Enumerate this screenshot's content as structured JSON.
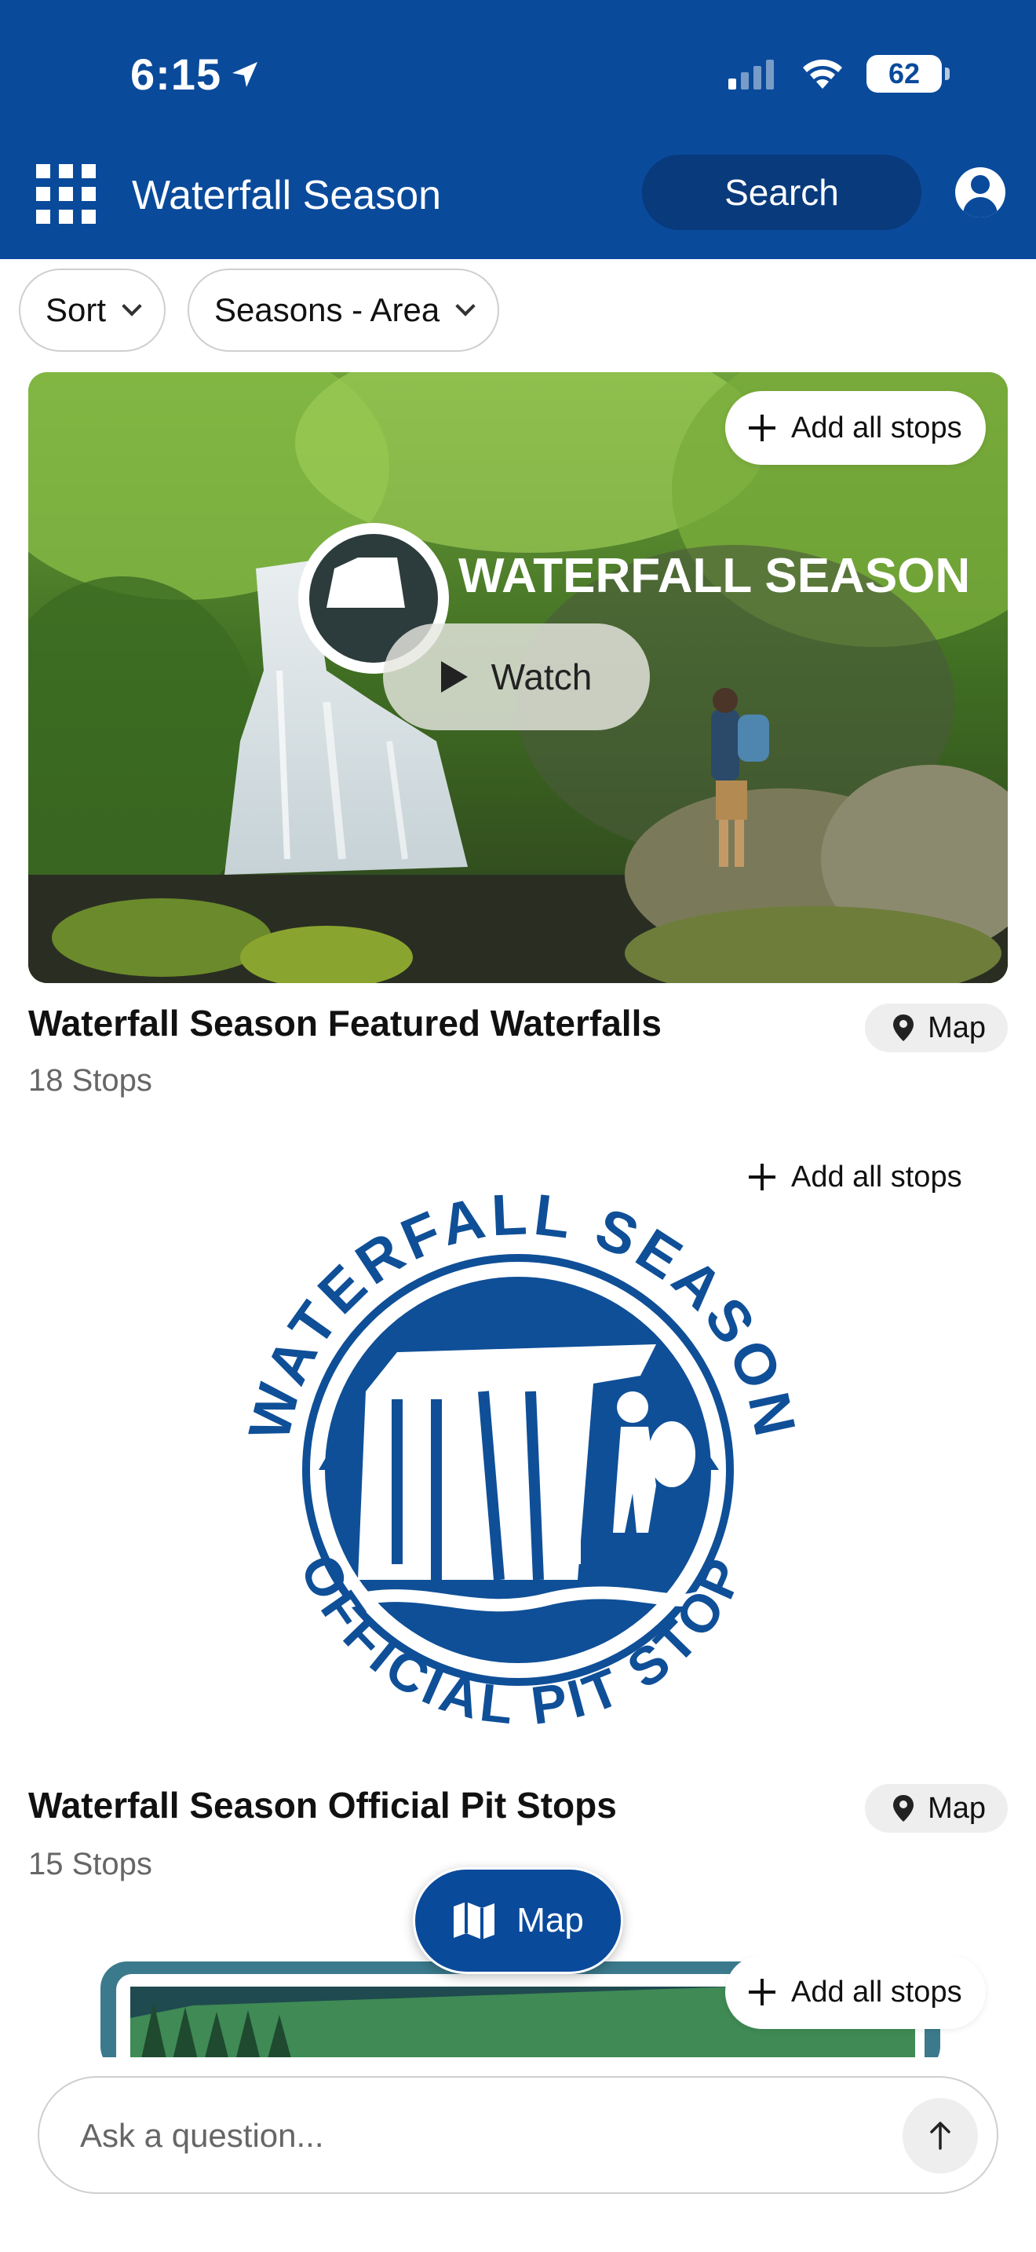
{
  "status_bar": {
    "time": "6:15",
    "battery": "62"
  },
  "header": {
    "title": "Waterfall Season",
    "search_label": "Search"
  },
  "filters": [
    {
      "label": "Sort"
    },
    {
      "label": "Seasons - Area"
    }
  ],
  "cards": [
    {
      "title": "Waterfall Season Featured Waterfalls",
      "stops": "18 Stops",
      "add_all_label": "Add all stops",
      "map_label": "Map",
      "watch_label": "Watch",
      "image_logo_text": "WATERFALL SEASON"
    },
    {
      "title": "Waterfall Season Official Pit Stops",
      "stops": "15 Stops",
      "add_all_label": "Add all stops",
      "map_label": "Map",
      "logo_top_text": "WATERFALL SEASON",
      "logo_bottom_text": "OFFICIAL PIT STOP"
    },
    {
      "add_all_label": "Add all stops"
    }
  ],
  "floating_map_label": "Map",
  "ask": {
    "placeholder": "Ask a question..."
  },
  "colors": {
    "brand": "#0a4a9b",
    "logo_blue": "#0f4f97"
  }
}
